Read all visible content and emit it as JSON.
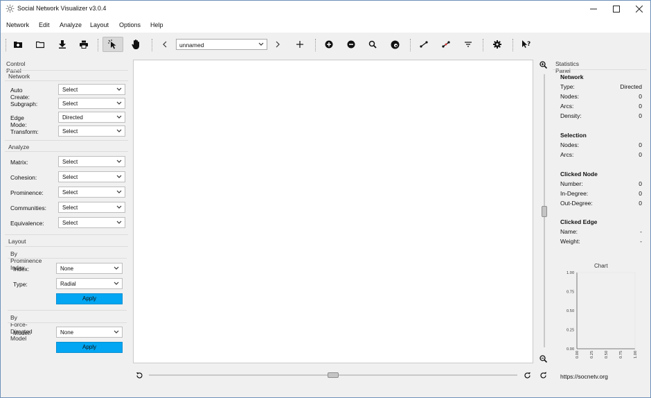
{
  "window": {
    "title": "Social Network Visualizer v3.0.4",
    "controls": {
      "minimize": "—",
      "maximize": "☐",
      "close": "✕"
    }
  },
  "menu": [
    "Network",
    "Edit",
    "Analyze",
    "Layout",
    "Options",
    "Help"
  ],
  "toolbar": {
    "relation_combo": "unnamed",
    "icons": [
      "open-folder-icon",
      "folder-icon",
      "download-icon",
      "print-icon",
      "select-pointer-icon",
      "hand-pointer-icon",
      "chevron-left-icon",
      "chevron-right-icon",
      "plus-icon",
      "zoom-in-icon",
      "zoom-out-icon",
      "search-icon",
      "node-focus-icon",
      "add-edge-icon",
      "remove-edge-icon",
      "filter-icon",
      "settings-gear-icon",
      "help-question-icon"
    ]
  },
  "control_panel": {
    "title": "Control Panel",
    "network": {
      "header": "Network",
      "rows": [
        {
          "label": "Auto Create:",
          "value": "Select"
        },
        {
          "label": "Subgraph:",
          "value": "Select"
        },
        {
          "label": "Edge Mode:",
          "value": "Directed"
        },
        {
          "label": "Transform:",
          "value": "Select"
        }
      ]
    },
    "analyze": {
      "header": "Analyze",
      "rows": [
        {
          "label": "Matrix:",
          "value": "Select"
        },
        {
          "label": "Cohesion:",
          "value": "Select"
        },
        {
          "label": "Prominence:",
          "value": "Select"
        },
        {
          "label": "Communities:",
          "value": "Select"
        },
        {
          "label": "Equivalence:",
          "value": "Select"
        }
      ]
    },
    "layout": {
      "header": "Layout",
      "prominence": {
        "header": "By Prominence Index",
        "index_label": "Index:",
        "index_value": "None",
        "type_label": "Type:",
        "type_value": "Radial",
        "apply": "Apply"
      },
      "force": {
        "header": "By Force-Directed Model",
        "model_label": "Model:",
        "model_value": "None",
        "apply": "Apply"
      }
    }
  },
  "statistics": {
    "title": "Statistics Panel",
    "network": {
      "header": "Network",
      "rows": [
        {
          "label": "Type:",
          "value": "Directed"
        },
        {
          "label": "Nodes:",
          "value": "0"
        },
        {
          "label": "Arcs:",
          "value": "0"
        },
        {
          "label": "Density:",
          "value": "0"
        }
      ]
    },
    "selection": {
      "header": "Selection",
      "rows": [
        {
          "label": "Nodes:",
          "value": "0"
        },
        {
          "label": "Arcs:",
          "value": "0"
        }
      ]
    },
    "clicked_node": {
      "header": "Clicked Node",
      "rows": [
        {
          "label": "Number:",
          "value": "0"
        },
        {
          "label": "In-Degree:",
          "value": "0"
        },
        {
          "label": "Out-Degree:",
          "value": "0"
        }
      ]
    },
    "clicked_edge": {
      "header": "Clicked Edge",
      "rows": [
        {
          "label": "Name:",
          "value": "-"
        },
        {
          "label": "Weight:",
          "value": "-"
        }
      ]
    },
    "chart": {
      "title": "Chart",
      "y_ticks": [
        "1.00",
        "0.75",
        "0.50",
        "0.25",
        "0.00"
      ],
      "x_ticks": [
        "0.00",
        "0.25",
        "0.50",
        "0.75",
        "1.00"
      ]
    },
    "link": "https://socnetv.org"
  },
  "colors": {
    "accent": "#02a6f2",
    "canvas": "#ffffff",
    "bg": "#f0f0f0"
  }
}
